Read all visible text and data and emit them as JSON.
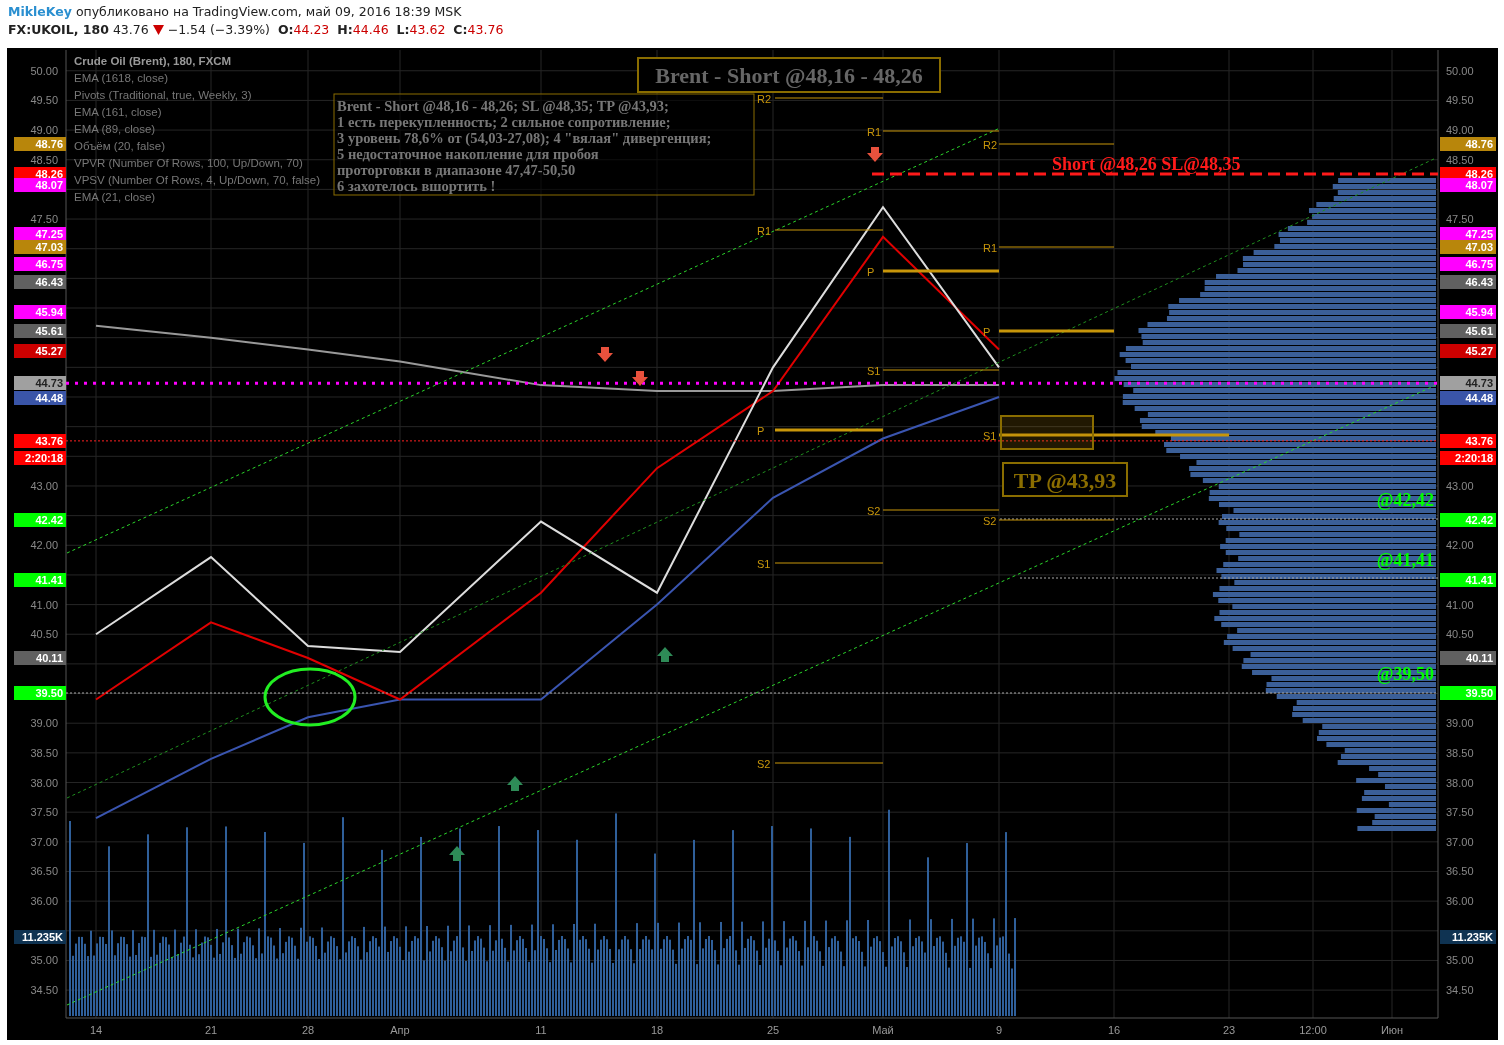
{
  "header": {
    "author": "MikleKey",
    "published": "опубликовано на TradingView.com, май 09, 2016 18:39 MSK",
    "symbol": "FX:UKOIL, 180",
    "last": "43.76",
    "change": "−1.54 (−3.39%)",
    "ohlc": [
      {
        "label": "O:",
        "value": "44.23"
      },
      {
        "label": "H:",
        "value": "44.46"
      },
      {
        "label": "L:",
        "value": "43.62"
      },
      {
        "label": "C:",
        "value": "43.76"
      }
    ]
  },
  "legend": [
    "Crude Oil (Brent), 180, FXCM",
    "EMA (1618, close)",
    "Pivots (Traditional, true, Weekly, 3)",
    "EMA (161, close)",
    "EMA (89, close)",
    "Объём (20, false)",
    "VPVR (Number Of Rows, 100, Up/Down, 70)",
    "VPSV (Number Of Rows, 4, Up/Down, 70, false)",
    "EMA (21, close)"
  ],
  "annotations": {
    "title": "Brent - Short @48,16 - 48,26",
    "note": [
      "Brent - Short @48,16 - 48,26; SL @48,35; TP @43,93;",
      "1 есть перекупленность; 2 сильное сопротивление;",
      "3 уровень 78,6% от (54,03-27,08); 4 \"вялая\" дивергенция;",
      "5 недостаточное накопление для пробоя",
      "проторговки в диапазоне 47,47-50,50",
      "6 захотелось вшортить !"
    ],
    "short": "Short @48,26 SL@48,35",
    "tp": "TP @43,93",
    "targets": [
      "@42,42",
      "@41,41",
      "@39,50"
    ]
  },
  "pivot_labels": [
    "R2",
    "R1",
    "R2",
    "R1",
    "R1",
    "P",
    "P",
    "S1",
    "P",
    "S1",
    "S2",
    "S2",
    "S1",
    "S2"
  ],
  "right_ticks": [
    "50.00",
    "49.50",
    "49.00",
    "48.50",
    "47.50",
    "43.00",
    "42.00",
    "41.00",
    "40.50",
    "39.00",
    "38.50",
    "38.00",
    "37.50",
    "37.00",
    "36.50",
    "36.00",
    "35.00",
    "34.50"
  ],
  "left_tags": [
    {
      "text": "48.76",
      "color": "#b8860b"
    },
    {
      "text": "48.26",
      "color": "#ff0000"
    },
    {
      "text": "48.07",
      "color": "#ff00ff"
    },
    {
      "text": "47.25",
      "color": "#ff00ff"
    },
    {
      "text": "47.03",
      "color": "#b8860b"
    },
    {
      "text": "46.75",
      "color": "#ff00ff"
    },
    {
      "text": "46.43",
      "color": "#606060"
    },
    {
      "text": "45.94",
      "color": "#ff00ff"
    },
    {
      "text": "45.61",
      "color": "#606060"
    },
    {
      "text": "45.27",
      "color": "#cc0000"
    },
    {
      "text": "44.73",
      "color": "#a0a0a0"
    },
    {
      "text": "44.48",
      "color": "#3a55a8"
    },
    {
      "text": "43.76",
      "color": "#ff0000"
    },
    {
      "text": "2:20:18",
      "color": "#ff0000"
    },
    {
      "text": "42.42",
      "color": "#00ff00"
    },
    {
      "text": "41.41",
      "color": "#00ff00"
    },
    {
      "text": "40.11",
      "color": "#606060"
    },
    {
      "text": "39.50",
      "color": "#00ff00"
    },
    {
      "text": "11.235K",
      "color": "#0f3352"
    }
  ],
  "right_tags": [
    {
      "text": "48.76",
      "color": "#b8860b"
    },
    {
      "text": "48.26",
      "color": "#ff0000"
    },
    {
      "text": "48.07",
      "color": "#ff00ff"
    },
    {
      "text": "47.25",
      "color": "#ff00ff"
    },
    {
      "text": "47.03",
      "color": "#b8860b"
    },
    {
      "text": "46.75",
      "color": "#ff00ff"
    },
    {
      "text": "46.43",
      "color": "#606060"
    },
    {
      "text": "45.94",
      "color": "#ff00ff"
    },
    {
      "text": "45.61",
      "color": "#606060"
    },
    {
      "text": "45.27",
      "color": "#cc0000"
    },
    {
      "text": "44.73",
      "color": "#a0a0a0"
    },
    {
      "text": "44.48",
      "color": "#3a55a8"
    },
    {
      "text": "43.76",
      "color": "#ff0000"
    },
    {
      "text": "2:20:18",
      "color": "#ff0000"
    },
    {
      "text": "42.42",
      "color": "#00ff00"
    },
    {
      "text": "41.41",
      "color": "#00ff00"
    },
    {
      "text": "40.11",
      "color": "#606060"
    },
    {
      "text": "39.50",
      "color": "#00ff00"
    },
    {
      "text": "11.235K",
      "color": "#0f3352"
    }
  ],
  "chart_data": {
    "type": "line",
    "grid": true,
    "categories": [
      "14",
      "21",
      "28",
      "Апр",
      "11",
      "18",
      "25",
      "Май",
      "9",
      "16",
      "23",
      "12:00",
      "Июн"
    ],
    "ylim": [
      34.03,
      50.35
    ],
    "yticks": [
      {
        "value": 50,
        "label": "50.00"
      },
      {
        "value": 49.5,
        "label": "49.50"
      },
      {
        "value": 49,
        "label": "49.00"
      },
      {
        "value": 48.5,
        "label": "48.50"
      },
      {
        "value": 47.5,
        "label": "47.50"
      },
      {
        "value": 43,
        "label": "43.00"
      },
      {
        "value": 42,
        "label": "42.00"
      },
      {
        "value": 41,
        "label": "41.00"
      },
      {
        "value": 40.5,
        "label": "40.50"
      },
      {
        "value": 39,
        "label": "39.00"
      },
      {
        "value": 38.5,
        "label": "38.50"
      },
      {
        "value": 38,
        "label": "38.00"
      },
      {
        "value": 37.5,
        "label": "37.50"
      },
      {
        "value": 37,
        "label": "37.00"
      },
      {
        "value": 36.5,
        "label": "36.50"
      },
      {
        "value": 36,
        "label": "36.00"
      },
      {
        "value": 35,
        "label": "35.00"
      },
      {
        "value": 34.5,
        "label": "34.50"
      }
    ],
    "series": [
      {
        "color": "#999999",
        "values": [
          45.7,
          45.5,
          45.3,
          45.1,
          44.7,
          44.6,
          44.6,
          44.7,
          44.7,
          null,
          null,
          null,
          null
        ]
      },
      {
        "color": "#3a55b0",
        "values": [
          37.4,
          38.4,
          39.1,
          39.4,
          39.4,
          41.0,
          42.8,
          43.8,
          44.5,
          null,
          null,
          null,
          null
        ]
      },
      {
        "color": "#e00000",
        "values": [
          39.4,
          40.7,
          40.1,
          39.4,
          41.2,
          43.3,
          44.6,
          47.2,
          45.3,
          null,
          null,
          null,
          null
        ]
      },
      {
        "color": "#dddddd",
        "values": [
          40.5,
          41.8,
          40.3,
          40.2,
          42.4,
          41.2,
          45.0,
          47.7,
          45.0,
          null,
          null,
          null,
          null
        ]
      }
    ]
  }
}
